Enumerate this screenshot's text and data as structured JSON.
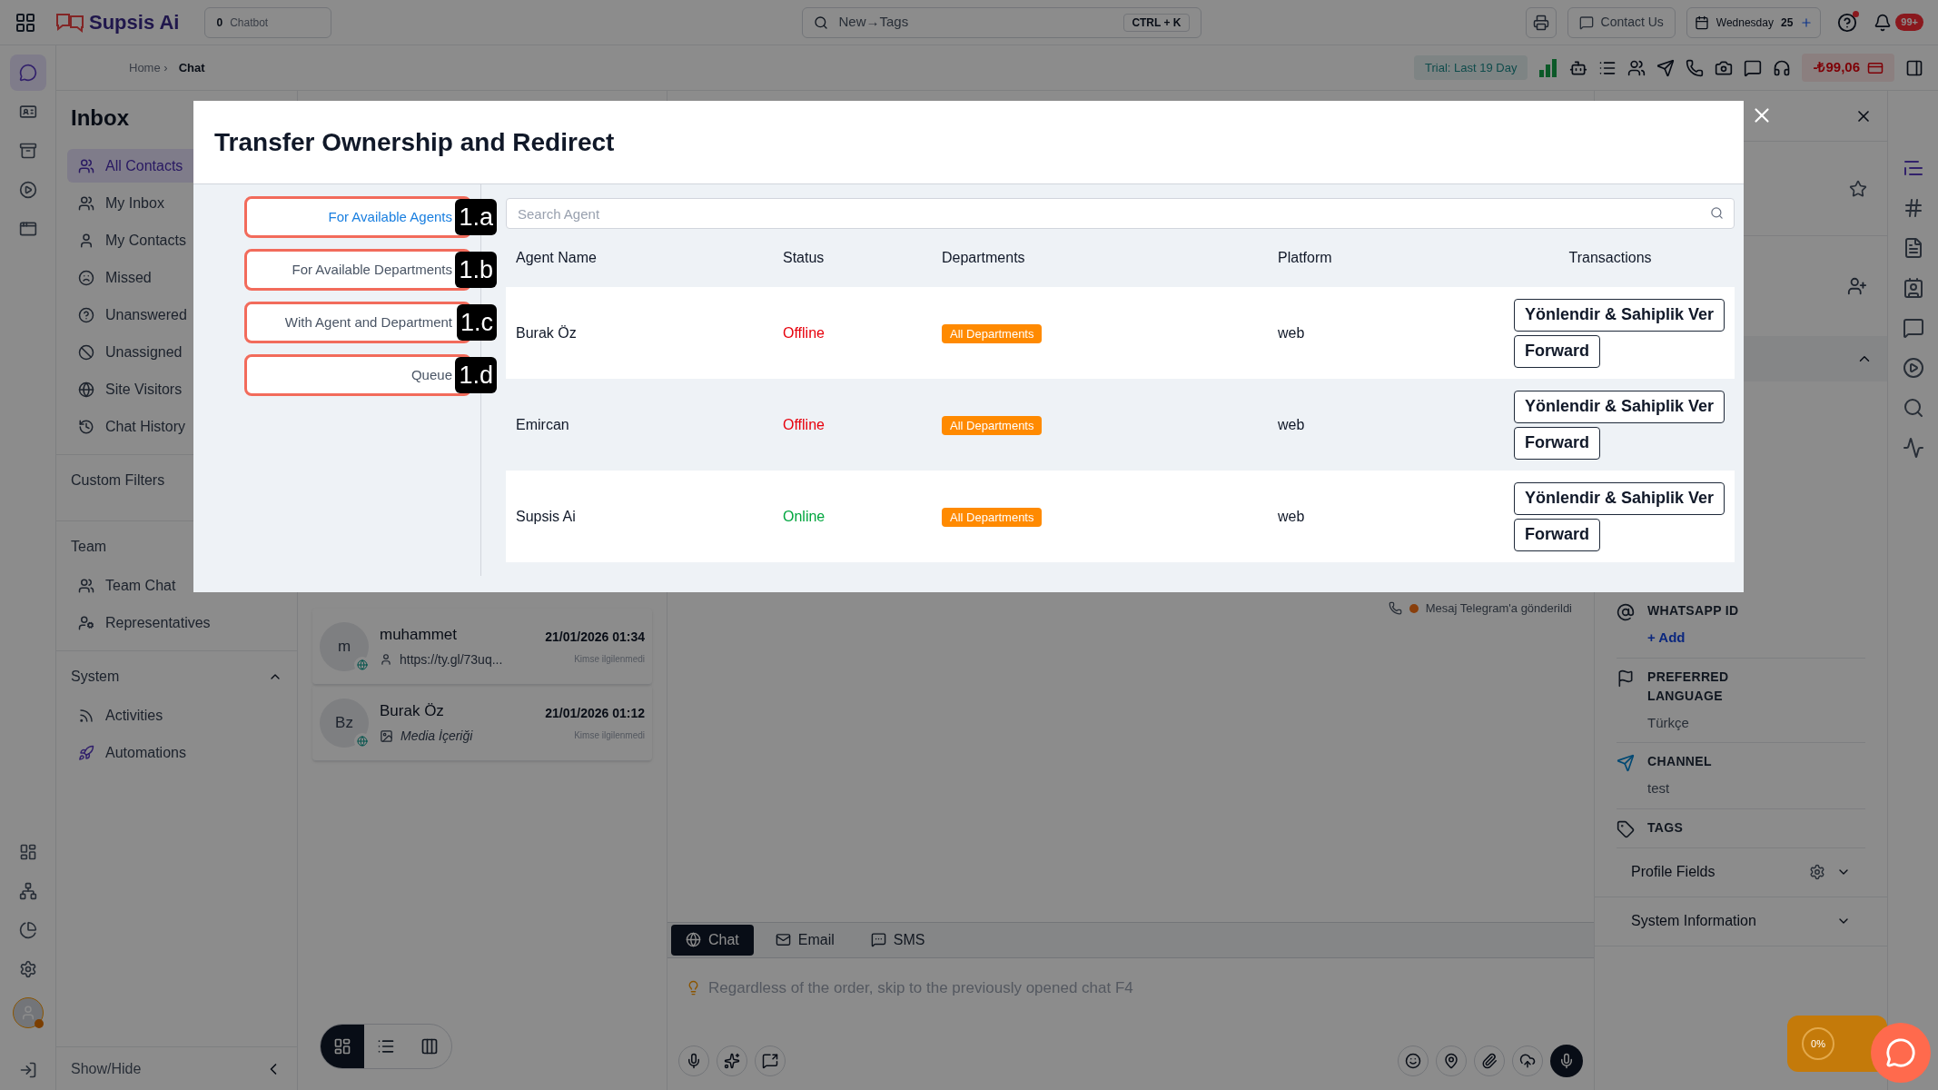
{
  "topbar": {
    "logo": "Supsis Ai",
    "chatbot_count": "0",
    "chatbot_label": "Chatbot",
    "search": {
      "value": "New→Tags",
      "shortcut": "CTRL + K"
    },
    "contact_us": "Contact Us",
    "date": "Wednesday",
    "date_day": "25",
    "notifications": "99+"
  },
  "breadcrumb": {
    "parent": "Home ›",
    "current": "Chat"
  },
  "trial": "Trial: Last 19 Day",
  "balance": "-₺99,06",
  "rail": {
    "top": [
      {
        "selected": true
      },
      {
        "selected": false
      },
      {
        "selected": false
      },
      {
        "selected": false
      },
      {
        "selected": false
      }
    ],
    "bottom": [
      {
        "selected": false
      },
      {
        "selected": false
      },
      {
        "selected": false
      },
      {
        "selected": false
      }
    ]
  },
  "sidebar": {
    "title": "Inbox",
    "items": [
      {
        "label": "All Contacts",
        "selected": true
      },
      {
        "label": "My Inbox",
        "selected": false
      },
      {
        "label": "My Contacts",
        "selected": false
      },
      {
        "label": "Missed",
        "selected": false
      },
      {
        "label": "Unanswered",
        "selected": false
      },
      {
        "label": "Unassigned",
        "selected": false
      },
      {
        "label": "Site Visitors",
        "selected": false
      },
      {
        "label": "Chat History",
        "selected": false
      }
    ],
    "custom_filters": "Custom Filters",
    "team": {
      "title": "Team",
      "items": [
        {
          "label": "Team Chat",
          "selected": false
        },
        {
          "label": "Representatives",
          "selected": false
        }
      ]
    },
    "system": {
      "title": "System",
      "expanded": true,
      "items": [
        {
          "label": "Activities",
          "selected": false
        },
        {
          "label": "Automations",
          "selected": false
        }
      ]
    },
    "show_hide": "Show/Hide"
  },
  "chat_list": [
    {
      "initials": "m",
      "name": "muhammet",
      "kind": "link",
      "preview": "https://ty.gl/73uq...",
      "time": "21/01/2026 01:34",
      "status": "Kimse ilgilenmedi"
    },
    {
      "initials": "Bz",
      "name": "Burak Öz",
      "kind": "media",
      "preview": "Media İçeriği",
      "time": "21/01/2026 01:12",
      "status": "Kimse ilgilenmedi"
    }
  ],
  "view_toggle": [
    {
      "selected": true
    },
    {
      "selected": false
    },
    {
      "selected": false
    }
  ],
  "chat": {
    "delivery": "Mesaj Telegram'a gönderildi",
    "channels": [
      {
        "label": "Chat",
        "selected": true
      },
      {
        "label": "Email",
        "selected": false
      },
      {
        "label": "SMS",
        "selected": false
      }
    ],
    "placeholder": "Regardless of the order, skip to the previously opened chat F4"
  },
  "right_panel": {
    "fields": [
      {
        "label": "WHATSAPP ID",
        "value": "+ Add",
        "kind": "link"
      },
      {
        "label": "PREFERRED LANGUAGE",
        "value": "Türkçe",
        "kind": "text"
      },
      {
        "label": "CHANNEL",
        "value": "test",
        "kind": "text"
      },
      {
        "label": "TAGS"
      }
    ],
    "sections": [
      {
        "label": "Profile Fields",
        "settings": true,
        "expanded": false
      },
      {
        "label": "System Information",
        "settings": false,
        "expanded": false
      }
    ]
  },
  "widget": {
    "progress": "0%"
  },
  "modal": {
    "title": "Transfer Ownership and Redirect",
    "tabs": [
      {
        "label": "For Available Agents",
        "selected": true,
        "annotation": "1.a"
      },
      {
        "label": "For Available Departments",
        "selected": false,
        "annotation": "1.b"
      },
      {
        "label": "With Agent and Department",
        "selected": false,
        "annotation": "1.c"
      },
      {
        "label": "Queue",
        "selected": false,
        "annotation": "1.d"
      }
    ],
    "search_placeholder": "Search Agent",
    "columns": [
      "Agent Name",
      "Status",
      "Departments",
      "Platform",
      "Transactions"
    ],
    "rows": [
      {
        "name": "Burak Öz",
        "status": "Offline",
        "online": false,
        "department": "All Departments",
        "platform": "web",
        "actions": [
          "Yönlendir & Sahiplik Ver",
          "Forward"
        ]
      },
      {
        "name": "Emircan",
        "status": "Offline",
        "online": false,
        "department": "All Departments",
        "platform": "web",
        "actions": [
          "Yönlendir & Sahiplik Ver",
          "Forward"
        ]
      },
      {
        "name": "Supsis Ai",
        "status": "Online",
        "online": true,
        "department": "All Departments",
        "platform": "web",
        "actions": [
          "Yönlendir & Sahiplik Ver",
          "Forward"
        ]
      }
    ]
  }
}
